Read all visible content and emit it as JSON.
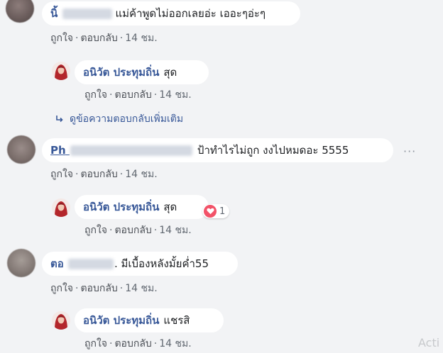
{
  "comments": [
    {
      "author_prefix": "นิ้",
      "text": "แม่ค้าพูดไม่ออกเลยอ่ะ เออะๆอ่ะๆ",
      "like": "ถูกใจ",
      "reply": "ตอบกลับ",
      "time": "14 ชม."
    },
    {
      "author": "อนิวัต ประทุมถิ่น",
      "text": "สุด",
      "like": "ถูกใจ",
      "reply": "ตอบกลับ",
      "time": "14 ชม."
    },
    {
      "author_prefix": "Ph",
      "text": "ป้าทำไรไม่ถูก งงไปหมดอะ 5555",
      "like": "ถูกใจ",
      "reply": "ตอบกลับ",
      "time": "14 ชม."
    },
    {
      "author": "อนิวัต ประทุมถิ่น",
      "text": "สุด",
      "reaction_count": "1",
      "like": "ถูกใจ",
      "reply": "ตอบกลับ",
      "time": "14 ชม."
    },
    {
      "author_prefix": "ตอ",
      "text": ". มีเบื้องหลังมั้ยค่ำ55",
      "like": "ถูกใจ",
      "reply": "ตอบกลับ",
      "time": "14 ชม."
    },
    {
      "author": "อนิวัต ประทุมถิ่น",
      "text": "แชรสิ",
      "like": "ถูกใจ",
      "reply": "ตอบกลับ",
      "time": "14 ชม."
    }
  ],
  "more_replies": "ดูข้อความตอบกลับเพิ่มเติม",
  "more_options": "···",
  "watermark": "Acti",
  "icons": {
    "reply_arrow": "reply-arrow-icon",
    "heart": "heart-reaction-icon"
  },
  "colors": {
    "author": "#385898",
    "heart": "#f25268",
    "background": "#f2f3f5"
  }
}
